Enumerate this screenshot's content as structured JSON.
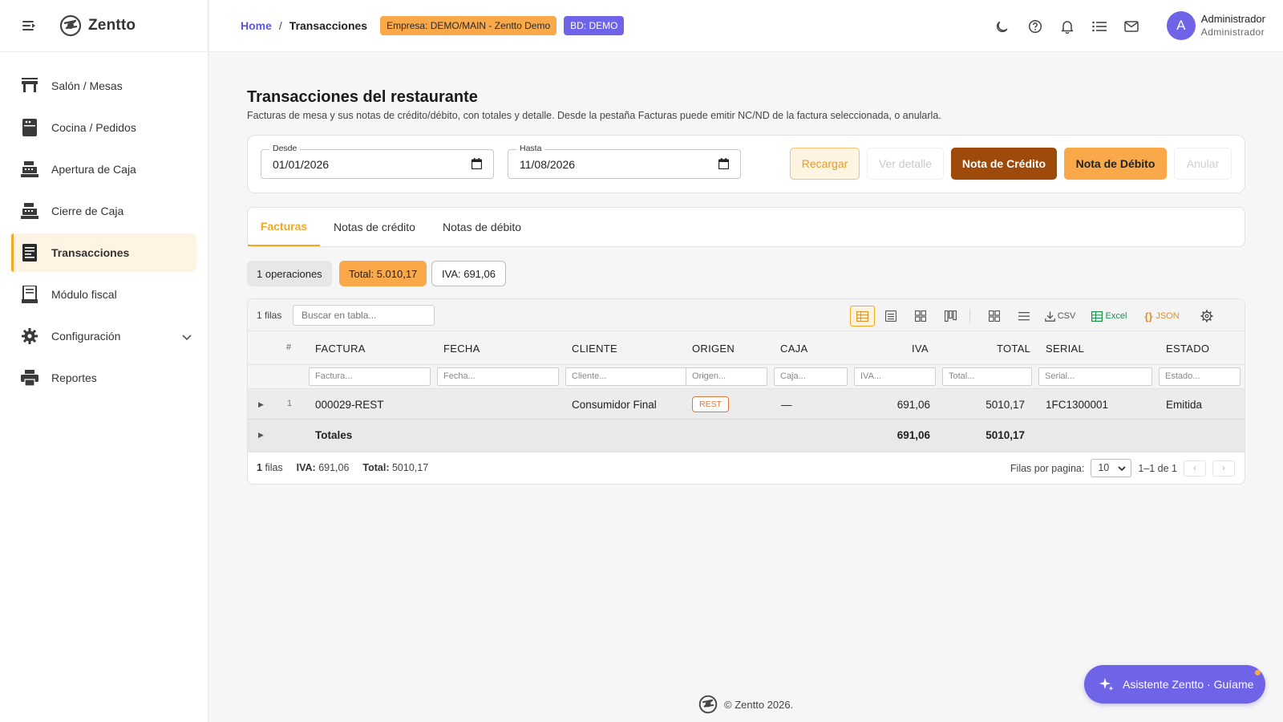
{
  "app": {
    "name": "Zentto"
  },
  "sidebar": {
    "items": [
      {
        "label": "Salón / Mesas",
        "icon": "table-icon"
      },
      {
        "label": "Cocina / Pedidos",
        "icon": "kitchen-icon"
      },
      {
        "label": "Apertura de Caja",
        "icon": "cash-register-icon"
      },
      {
        "label": "Cierre de Caja",
        "icon": "cash-register-icon"
      },
      {
        "label": "Transacciones",
        "icon": "receipt-icon",
        "active": true
      },
      {
        "label": "Módulo fiscal",
        "icon": "fiscal-printer-icon"
      },
      {
        "label": "Configuración",
        "icon": "gear-icon"
      },
      {
        "label": "Reportes",
        "icon": "printer-icon"
      }
    ]
  },
  "header": {
    "breadcrumb_home": "Home",
    "breadcrumb_sep": "/",
    "breadcrumb_current": "Transacciones",
    "company_chip": "Empresa: DEMO/MAIN - Zentto Demo",
    "db_chip": "BD: DEMO",
    "user": {
      "initial": "A",
      "name": "Administrador",
      "role": "Administrador"
    }
  },
  "page": {
    "title": "Transacciones del restaurante",
    "description": "Facturas de mesa y sus notas de crédito/débito, con totales y detalle. Desde la pestaña Facturas puede emitir NC/ND de la factura seleccionada, o anularla."
  },
  "filters": {
    "from_label": "Desde",
    "from_value": "01/01/2026",
    "to_label": "Hasta",
    "to_value": "11/08/2026",
    "reload": "Recargar",
    "view_detail": "Ver detalle",
    "credit_note": "Nota de Crédito",
    "debit_note": "Nota de Débito",
    "cancel": "Anular"
  },
  "tabs": [
    "Facturas",
    "Notas de crédito",
    "Notas de débito"
  ],
  "summary": {
    "ops": "1 operaciones",
    "total": "Total: 5.010,17",
    "iva": "IVA: 691,06"
  },
  "grid": {
    "rows_count": "1 filas",
    "search_placeholder": "Buscar en tabla...",
    "csv": "CSV",
    "excel": "Excel",
    "json": "JSON",
    "columns": [
      "#",
      "FACTURA",
      "FECHA",
      "CLIENTE",
      "ORIGEN",
      "CAJA",
      "IVA",
      "TOTAL",
      "SERIAL",
      "ESTADO"
    ],
    "filter_placeholders": [
      "Factura...",
      "Fecha...",
      "Cliente...",
      "Origen...",
      "Caja...",
      "IVA...",
      "Total...",
      "Serial...",
      "Estado..."
    ],
    "rows": [
      {
        "num": "1",
        "factura": "000029-REST",
        "fecha": "",
        "cliente": "Consumidor Final",
        "origen": "REST",
        "caja": "—",
        "iva": "691,06",
        "total": "5010,17",
        "serial": "1FC1300001",
        "estado": "Emitida"
      }
    ],
    "totals": {
      "label": "Totales",
      "iva": "691,06",
      "total": "5010,17"
    },
    "footer": {
      "rows_num": "1",
      "rows_word": "filas",
      "iva_label": "IVA:",
      "iva_value": "691,06",
      "total_label": "Total:",
      "total_value": "5010,17",
      "per_page_label": "Filas por pagina:",
      "per_page_value": "10",
      "range": "1–1 de 1",
      "prev": "‹",
      "next": "›"
    }
  },
  "footer": {
    "text": "© Zentto 2026."
  },
  "assistant": {
    "label": "Asistente Zentto · Guíame"
  },
  "colors": {
    "accent": "#f5a623",
    "brand": "#6f63e8",
    "credit_note": "#9e4a0a"
  }
}
